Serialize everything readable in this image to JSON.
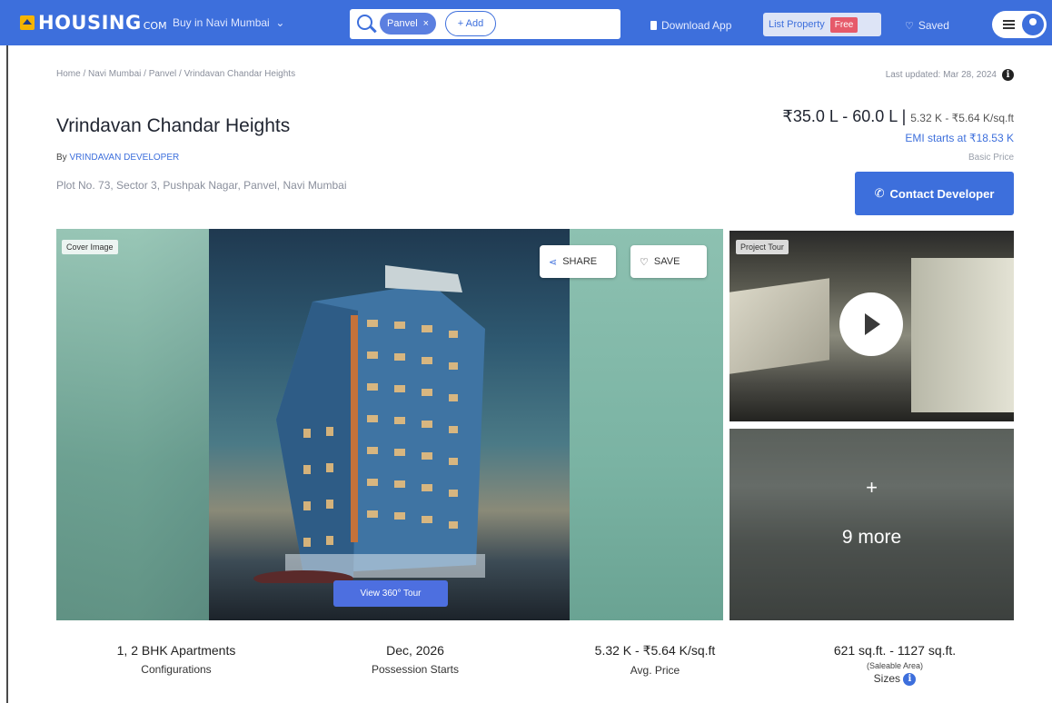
{
  "nav": {
    "logo_text": "HOUSING",
    "logo_tld": "COM",
    "buy_dropdown": "Buy in Navi Mumbai",
    "search_chip": "Panvel",
    "add_label": "+ Add",
    "download_app": "Download App",
    "list_property": "List Property",
    "free_badge": "Free",
    "saved": "Saved"
  },
  "breadcrumb": "Home / Navi Mumbai / Panvel / Vrindavan Chandar Heights",
  "last_updated": "Last updated: Mar 28, 2024",
  "project": {
    "title": "Vrindavan Chandar Heights",
    "by_prefix": "By",
    "developer": "VRINDAVAN DEVELOPER",
    "address": "Plot No. 73, Sector 3, Pushpak Nagar, Panvel, Navi Mumbai"
  },
  "pricing": {
    "range": "₹35.0 L - 60.0 L",
    "separator": "|",
    "per_sqft": "5.32 K - ₹5.64 K/sq.ft",
    "emi": "EMI starts at ₹18.53 K",
    "basic_price": "Basic Price",
    "contact_button": "Contact Developer"
  },
  "media": {
    "cover_tag": "Cover Image",
    "share": "SHARE",
    "save": "SAVE",
    "view_tour": "View 360° Tour",
    "project_tour_tag": "Project Tour",
    "more_plus": "+",
    "more_count": "9 more"
  },
  "highlights": [
    {
      "value": "1, 2 BHK Apartments",
      "label": "Configurations"
    },
    {
      "value": "Dec, 2026",
      "label": "Possession Starts"
    },
    {
      "value": "5.32 K - ₹5.64 K/sq.ft",
      "label": "Avg. Price"
    },
    {
      "value": "621 sq.ft. - 1127 sq.ft.",
      "sub": "(Saleable Area)",
      "label": "Sizes"
    }
  ],
  "colors": {
    "brand": "#3d6fdc",
    "free_badge": "#e65a6a",
    "logo_mark": "#f5b400"
  }
}
